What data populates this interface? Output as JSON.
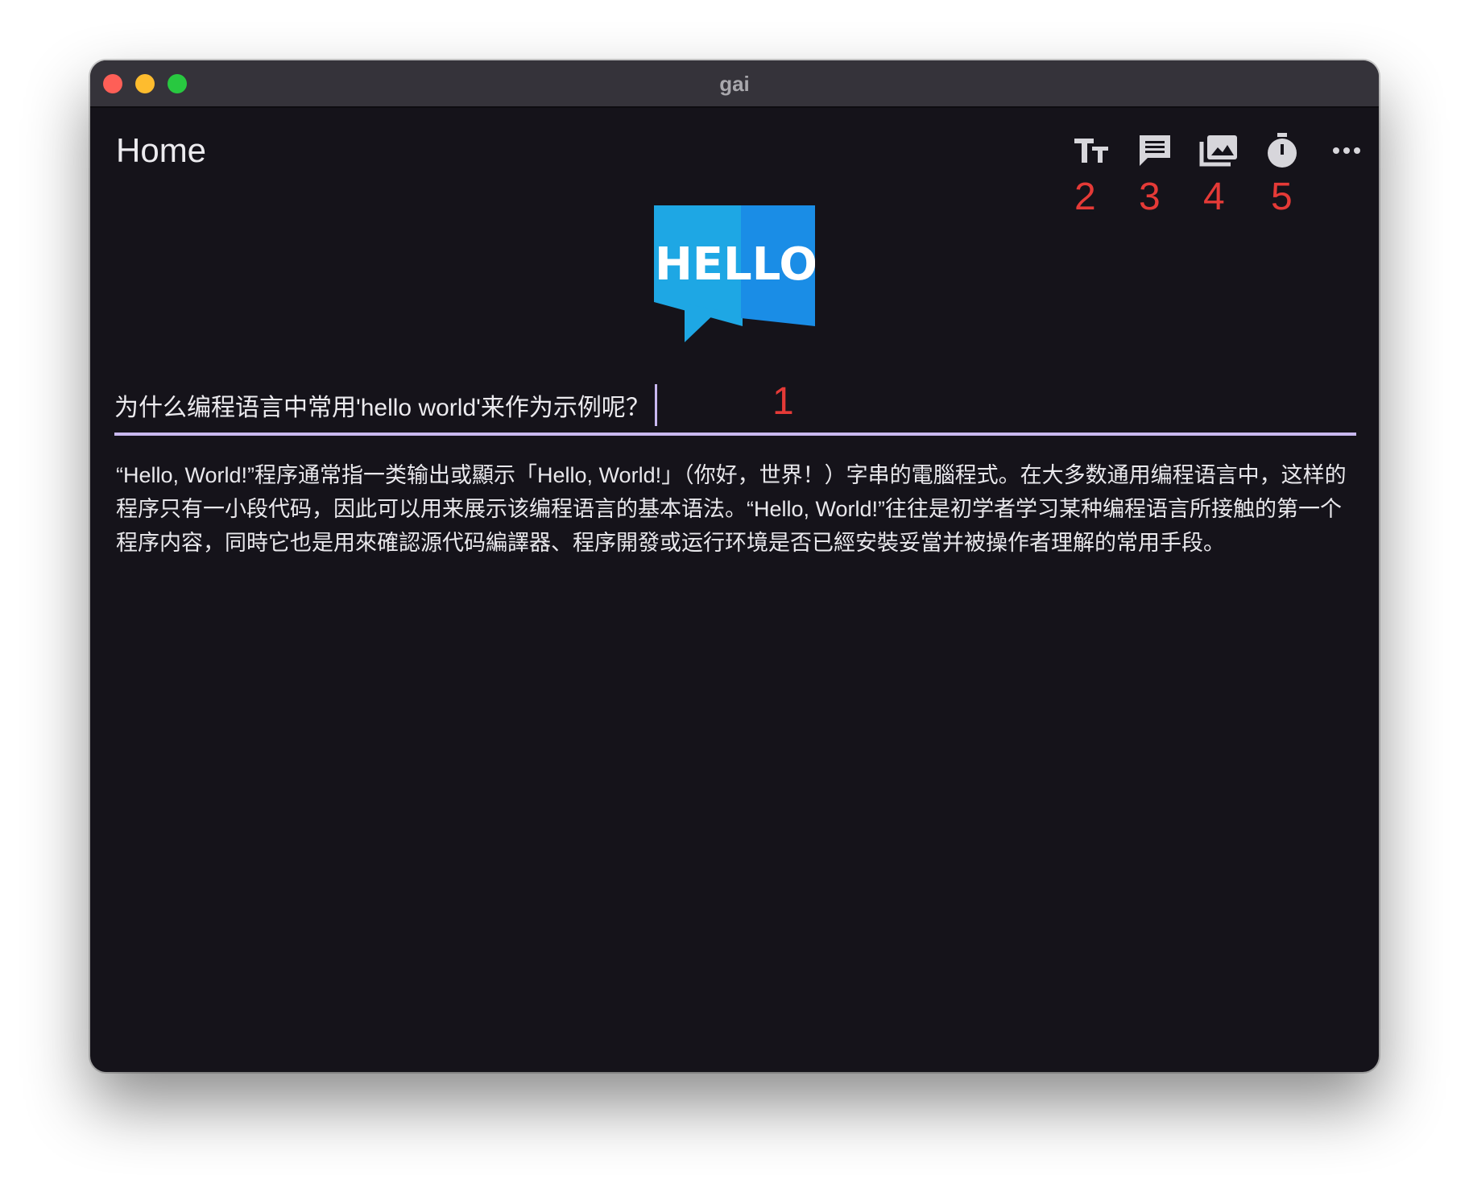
{
  "window": {
    "title": "gai"
  },
  "header": {
    "title": "Home"
  },
  "toolbar": {
    "items": [
      {
        "icon": "text-size-icon",
        "marker": "2"
      },
      {
        "icon": "chat-icon",
        "marker": "3"
      },
      {
        "icon": "image-gallery-icon",
        "marker": "4"
      },
      {
        "icon": "timer-icon",
        "marker": "5"
      },
      {
        "icon": "more-icon"
      }
    ]
  },
  "logo": {
    "text": "HELLO"
  },
  "question": {
    "value": "为什么编程语言中常用'hello world'来作为示例呢？",
    "marker": "1"
  },
  "answer": {
    "text": "“Hello, World!”程序通常指一类输出或顯示「Hello, World!」（你好，世界！）字串的電腦程式。在大多数通用编程语言中，这样的程序只有一小段代码，因此可以用来展示该编程语言的基本语法。“Hello, World!”往往是初学者学习某种编程语言所接触的第一个程序内容，同時它也是用來確認源代码編譯器、程序開發或运行环境是否已經安裝妥當并被操作者理解的常用手段。"
  },
  "colors": {
    "background": "#15131a",
    "titlebar": "#35333a",
    "accent": "#c9b8f0",
    "marker": "#e53a37",
    "logo_left": "#1ea7e4",
    "logo_right": "#1a8de6"
  }
}
